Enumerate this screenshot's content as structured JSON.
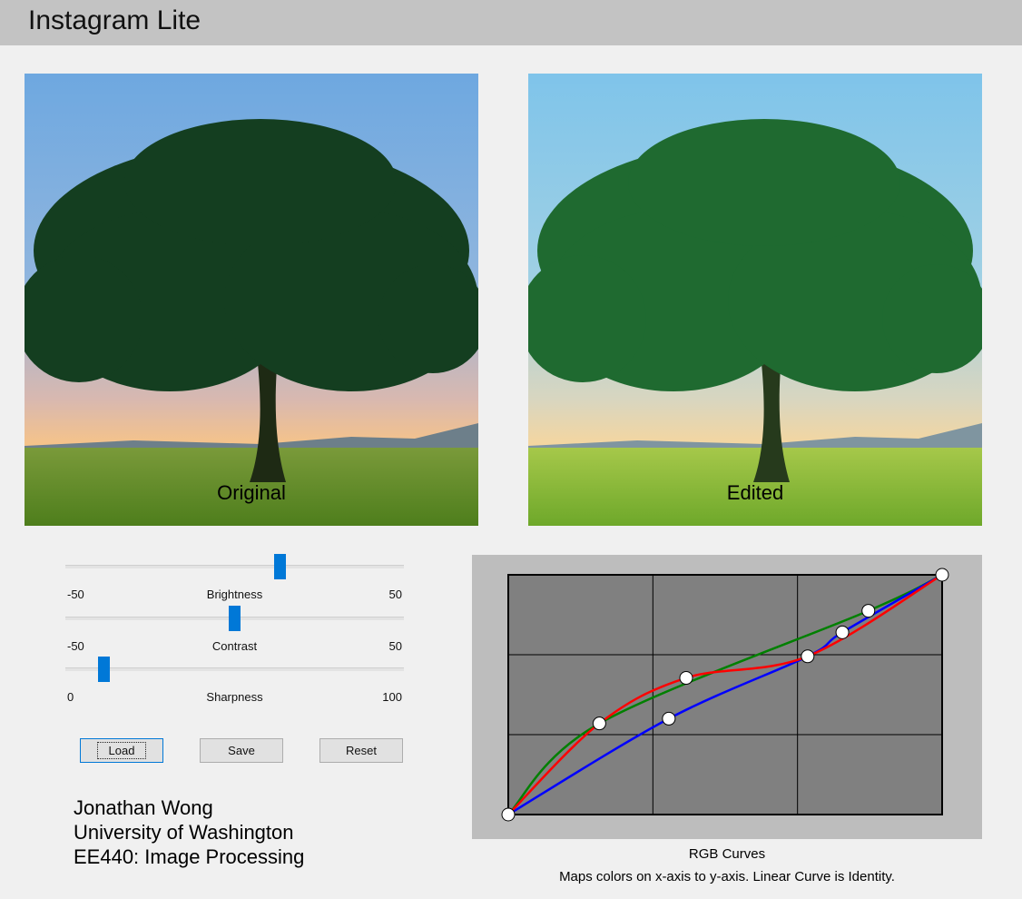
{
  "app": {
    "title": "Instagram Lite"
  },
  "images": {
    "original_label": "Original",
    "edited_label": "Edited"
  },
  "sliders": [
    {
      "name": "Brightness",
      "min": "-50",
      "max": "50",
      "value": 14
    },
    {
      "name": "Contrast",
      "min": "-50",
      "max": "50",
      "value": 0
    },
    {
      "name": "Sharpness",
      "min": "0",
      "max": "100",
      "value": 10
    }
  ],
  "buttons": {
    "load": "Load",
    "save": "Save",
    "reset": "Reset"
  },
  "credits": {
    "author": "Jonathan Wong",
    "school": "University of Washington",
    "course": "EE440: Image Processing"
  },
  "curves": {
    "title": "RGB Curves",
    "description": "Maps colors on x-axis to y-axis. Linear Curve is Identity.",
    "colors": {
      "red": "#ff0000",
      "green": "#008000",
      "blue": "#0000ff",
      "background": "#808080",
      "grid": "#000000"
    },
    "green_points": [
      [
        0,
        0
      ],
      [
        0.21,
        0.38
      ],
      [
        0.83,
        0.85
      ],
      [
        1,
        1
      ]
    ],
    "red_points": [
      [
        0,
        0
      ],
      [
        0.21,
        0.38
      ],
      [
        0.41,
        0.57
      ],
      [
        0.69,
        0.66
      ],
      [
        1,
        1
      ]
    ],
    "blue_points": [
      [
        0,
        0
      ],
      [
        0.37,
        0.4
      ],
      [
        0.69,
        0.66
      ],
      [
        0.77,
        0.76
      ],
      [
        1,
        1
      ]
    ],
    "control_points": [
      [
        0,
        0
      ],
      [
        0.21,
        0.38
      ],
      [
        0.41,
        0.57
      ],
      [
        0.37,
        0.4
      ],
      [
        0.69,
        0.66
      ],
      [
        0.77,
        0.76
      ],
      [
        0.83,
        0.85
      ],
      [
        1,
        1
      ]
    ]
  }
}
